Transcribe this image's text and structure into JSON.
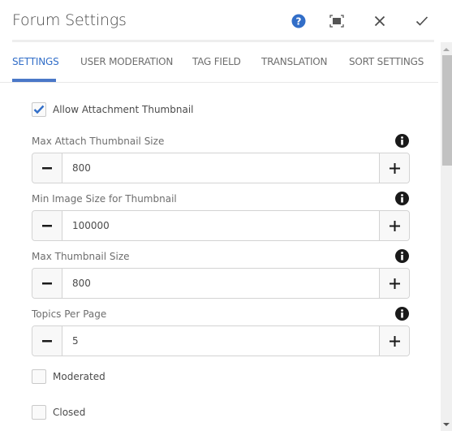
{
  "header": {
    "title": "Forum Settings",
    "buttons": {
      "help": "help-icon",
      "fullscreen": "fullscreen-icon",
      "close": "close-icon",
      "done": "check-icon"
    }
  },
  "tabs": [
    {
      "label": "SETTINGS",
      "active": true
    },
    {
      "label": "USER MODERATION",
      "active": false
    },
    {
      "label": "TAG FIELD",
      "active": false
    },
    {
      "label": "TRANSLATION",
      "active": false
    },
    {
      "label": "SORT SETTINGS",
      "active": false
    }
  ],
  "settings": {
    "allow_attachment_thumbnail": {
      "label": "Allow Attachment Thumbnail",
      "checked": true
    },
    "fields": [
      {
        "label": "Max Attach Thumbnail Size",
        "value": "800"
      },
      {
        "label": "Min Image Size for Thumbnail",
        "value": "100000"
      },
      {
        "label": "Max Thumbnail Size",
        "value": "800"
      },
      {
        "label": "Topics Per Page",
        "value": "5"
      }
    ],
    "moderated": {
      "label": "Moderated",
      "checked": false
    },
    "closed": {
      "label": "Closed",
      "checked": false
    }
  },
  "colors": {
    "accent": "#326ec8",
    "tab_indicator": "#4b78c8",
    "text": "#4b4b4b",
    "muted_text": "#6e6e6e"
  }
}
